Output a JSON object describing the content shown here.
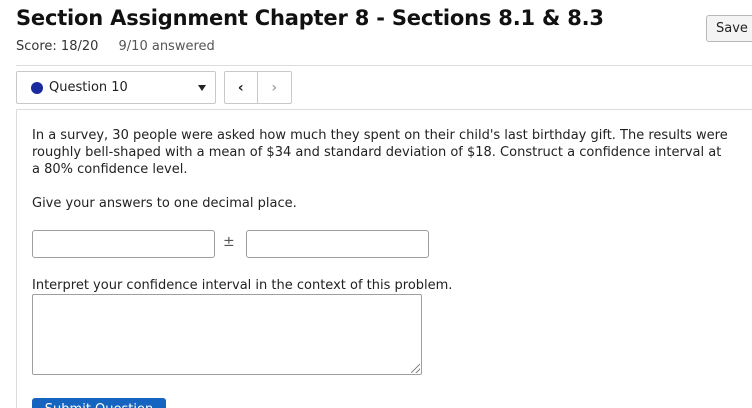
{
  "header": {
    "title": "Section Assignment Chapter 8 - Sections 8.1 & 8.3",
    "score_text": "Score: 18/20",
    "answered_text": "9/10 answered",
    "save_label": "Save"
  },
  "question_nav": {
    "selected_question": "Question 10",
    "status_dot_color": "#1a2a9e",
    "prev_icon": "chevron-left",
    "next_icon": "chevron-right"
  },
  "question": {
    "text": "In a survey, 30 people were asked how much they spent on their child's last birthday gift. The results were roughly bell-shaped with a mean of $34 and standard deviation of $18. Construct a confidence interval at a 80% confidence level.",
    "instructions": "Give your answers to one decimal place.",
    "answer_first_value": "",
    "plus_minus": "±",
    "answer_second_value": "",
    "interpret_label": "Interpret your confidence interval in the context of this problem.",
    "interpret_value": "",
    "submit_label": "Submit Question"
  }
}
